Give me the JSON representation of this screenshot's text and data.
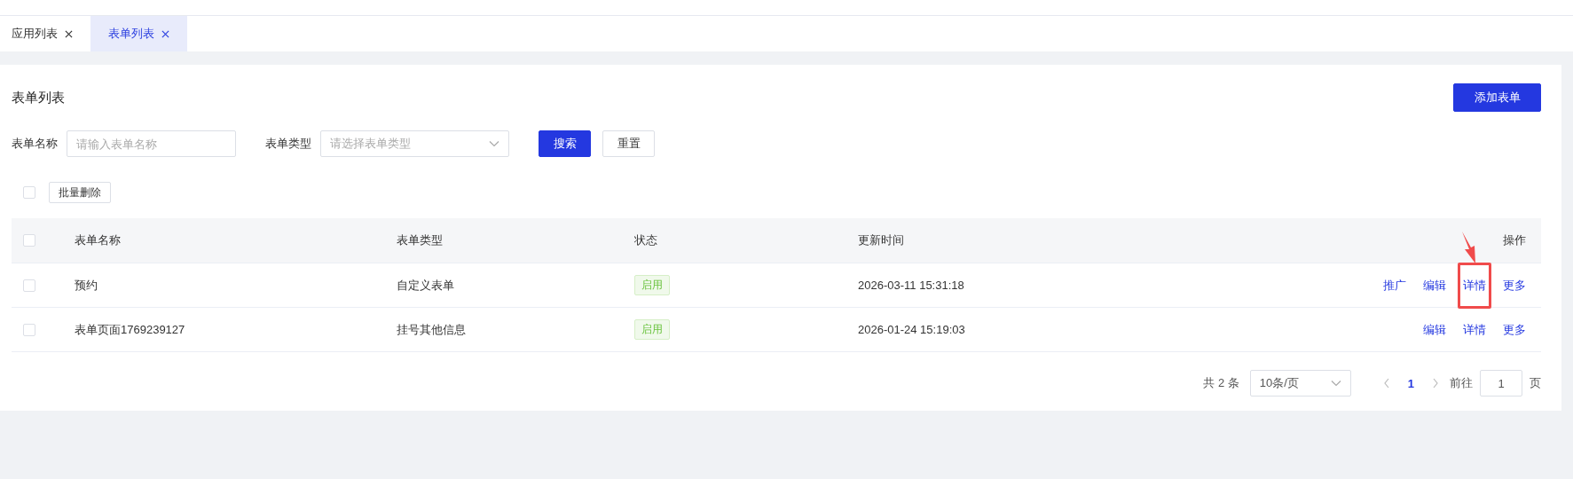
{
  "tabs": [
    {
      "label": "应用列表",
      "selected": false
    },
    {
      "label": "表单列表",
      "selected": true
    }
  ],
  "page_title": "表单列表",
  "add_button": "添加表单",
  "filters": [
    {
      "kind": "input",
      "label": "表单名称",
      "placeholder": "请输入表单名称"
    },
    {
      "kind": "select",
      "label": "表单类型",
      "placeholder": "请选择表单类型"
    }
  ],
  "search_button": "搜索",
  "reset_button": "重置",
  "batch": {
    "checked": false,
    "button": "批量删除"
  },
  "table": {
    "header_checked": false,
    "columns": [
      "表单名称",
      "表单类型",
      "状态",
      "更新时间",
      "操作"
    ],
    "rows": [
      {
        "checked": false,
        "name": "预约",
        "type": "自定义表单",
        "status": "启用",
        "updated": "2026-03-11 15:31:18",
        "actions": [
          {
            "label": "推广",
            "annotated": false
          },
          {
            "label": "编辑",
            "annotated": false
          },
          {
            "label": "详情",
            "annotated": true
          },
          {
            "label": "更多",
            "annotated": false
          }
        ]
      },
      {
        "checked": false,
        "name": "表单页面1769239127",
        "type": "挂号其他信息",
        "status": "启用",
        "updated": "2026-01-24 15:19:03",
        "actions": [
          {
            "label": "编辑",
            "annotated": false
          },
          {
            "label": "详情",
            "annotated": false
          },
          {
            "label": "更多",
            "annotated": false
          }
        ]
      }
    ]
  },
  "pagination": {
    "total": "共 2 条",
    "page_size": "10条/页",
    "pages": [
      {
        "label": "1",
        "selected": true
      }
    ],
    "goto_label": "前往",
    "goto_value": "1",
    "goto_suffix": "页"
  }
}
